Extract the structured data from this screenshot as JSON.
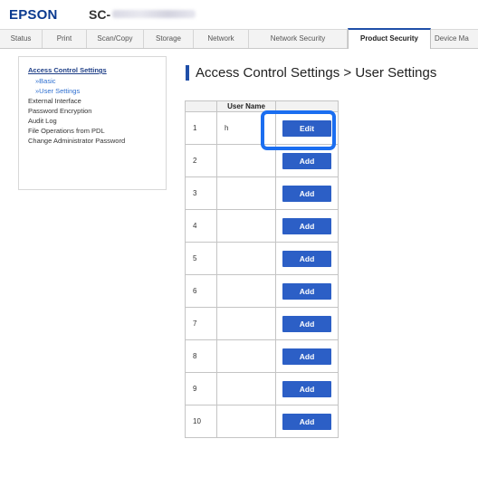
{
  "header": {
    "brand": "EPSON",
    "model": "SC-"
  },
  "tabs": [
    {
      "label": "Status",
      "active": false
    },
    {
      "label": "Print",
      "active": false
    },
    {
      "label": "Scan/Copy",
      "active": false
    },
    {
      "label": "Storage",
      "active": false
    },
    {
      "label": "Network",
      "active": false
    },
    {
      "label": "Network Security",
      "active": false
    },
    {
      "label": "Product Security",
      "active": true
    },
    {
      "label": "Device Ma",
      "active": false
    }
  ],
  "sidebar": {
    "heading": "Access Control Settings",
    "sub_items": [
      "»Basic",
      "»User Settings"
    ],
    "items": [
      "External Interface",
      "Password Encryption",
      "Audit Log",
      "File Operations from PDL",
      "Change Administrator Password"
    ]
  },
  "page": {
    "title": "Access Control Settings > User Settings"
  },
  "table": {
    "header_user_name": "User Name",
    "rows": [
      {
        "num": "1",
        "name": "h",
        "action": "Edit"
      },
      {
        "num": "2",
        "name": "",
        "action": "Add"
      },
      {
        "num": "3",
        "name": "",
        "action": "Add"
      },
      {
        "num": "4",
        "name": "",
        "action": "Add"
      },
      {
        "num": "5",
        "name": "",
        "action": "Add"
      },
      {
        "num": "6",
        "name": "",
        "action": "Add"
      },
      {
        "num": "7",
        "name": "",
        "action": "Add"
      },
      {
        "num": "8",
        "name": "",
        "action": "Add"
      },
      {
        "num": "9",
        "name": "",
        "action": "Add"
      },
      {
        "num": "10",
        "name": "",
        "action": "Add"
      }
    ]
  },
  "colors": {
    "brand": "#0b3a8f",
    "accent": "#1f4fa8",
    "button": "#2c5fc6",
    "highlight": "#1b6ef0"
  }
}
